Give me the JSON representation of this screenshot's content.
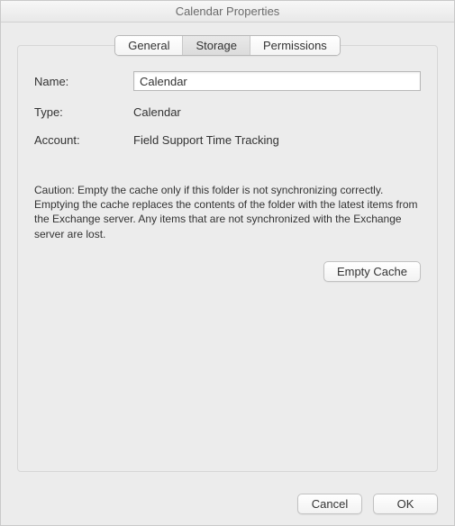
{
  "window": {
    "title": "Calendar Properties"
  },
  "tabs": {
    "general": "General",
    "storage": "Storage",
    "permissions": "Permissions"
  },
  "fields": {
    "name_label": "Name:",
    "name_value": "Calendar",
    "type_label": "Type:",
    "type_value": "Calendar",
    "account_label": "Account:",
    "account_value": "Field Support Time Tracking"
  },
  "caution_text": "Caution: Empty the cache only if this folder is not synchronizing correctly. Emptying the cache replaces the contents of the folder with the latest items from the Exchange server. Any items that are not synchronized with the Exchange server are lost.",
  "buttons": {
    "empty_cache": "Empty Cache",
    "cancel": "Cancel",
    "ok": "OK"
  }
}
